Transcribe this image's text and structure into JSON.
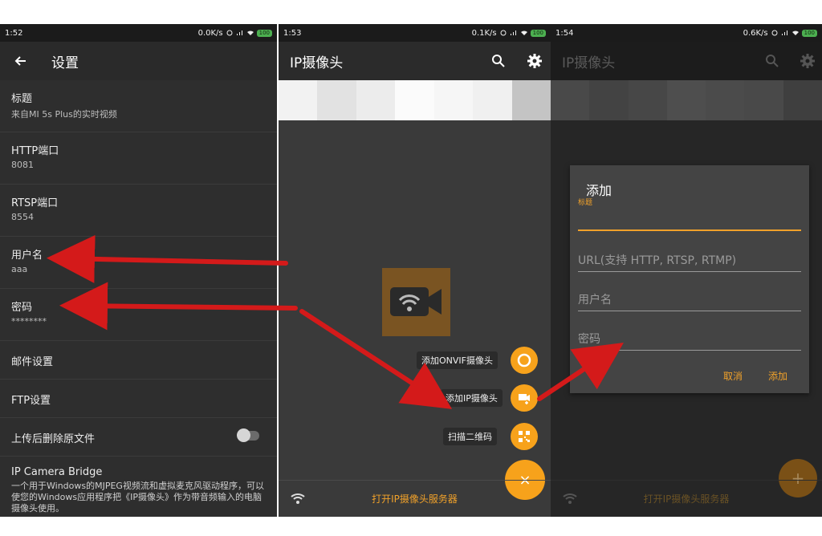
{
  "panel1": {
    "status": {
      "time": "1:52",
      "speed": "0.0K/s",
      "battery": "100"
    },
    "appbar": {
      "back_icon": "arrow-left-icon",
      "title": "设置"
    },
    "rows": [
      {
        "title": "标题",
        "subtitle": "来自MI 5s Plus的实时视频"
      },
      {
        "title": "HTTP端口",
        "subtitle": "8081"
      },
      {
        "title": "RTSP端口",
        "subtitle": "8554"
      },
      {
        "title": "用户名",
        "subtitle": "aaa"
      },
      {
        "title": "密码",
        "subtitle": "********"
      },
      {
        "title": "邮件设置"
      },
      {
        "title": "FTP设置"
      },
      {
        "title": "上传后删除原文件",
        "toggle": false
      },
      {
        "title": "IP Camera Bridge",
        "subtitle": "一个用于Windows的MJPEG视频流和虚拟麦克风驱动程序，可以使您的Windows应用程序把《IP摄像头》作为带音频输入的电脑摄像头使用。"
      }
    ]
  },
  "panel2": {
    "status": {
      "time": "1:53",
      "speed": "0.1K/s",
      "battery": "100"
    },
    "appbar": {
      "title": "IP摄像头",
      "search_icon": "search-icon",
      "settings_icon": "gear-icon"
    },
    "fab_menu": [
      {
        "label": "添加ONVIF摄像头",
        "icon": "ring-icon"
      },
      {
        "label": "添加IP摄像头",
        "icon": "add-camera-icon"
      },
      {
        "label": "扫描二维码",
        "icon": "qr-code-icon"
      }
    ],
    "main_fab": "×",
    "bottom": {
      "label": "打开IP摄像头服务器",
      "icon": "wifi-icon"
    }
  },
  "panel3": {
    "status": {
      "time": "1:54",
      "speed": "0.6K/s",
      "battery": "100"
    },
    "appbar": {
      "title": "IP摄像头"
    },
    "dialog": {
      "title": "添加",
      "fields": [
        {
          "label": "标题",
          "value": ""
        },
        {
          "placeholder": "URL(支持 HTTP, RTSP, RTMP)"
        },
        {
          "placeholder": "用户名"
        },
        {
          "placeholder": "密码"
        }
      ],
      "cancel": "取消",
      "add": "添加"
    },
    "fab": "+",
    "bottom": {
      "label": "打开IP摄像头服务器"
    }
  },
  "colors": {
    "accent": "#f7a21b",
    "arrow": "#d41a1a",
    "dark_bg": "#2e2e2e"
  }
}
